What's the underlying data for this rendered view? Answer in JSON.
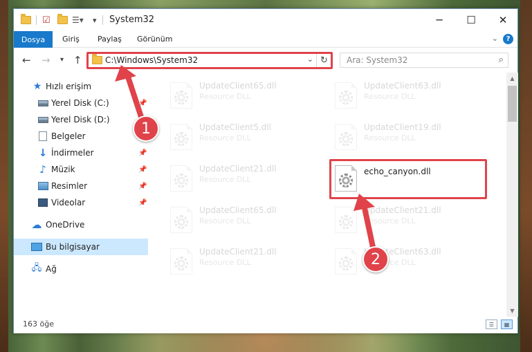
{
  "window": {
    "title": "System32",
    "controls": {
      "minimize": "─",
      "maximize": "☐",
      "close": "✕"
    }
  },
  "ribbon": {
    "tabs": [
      "Dosya",
      "Giriş",
      "Paylaş",
      "Görünüm"
    ],
    "help": "?"
  },
  "nav": {
    "address": "C:\\Windows\\System32",
    "search_placeholder": "Ara: System32"
  },
  "sidebar": {
    "items": [
      {
        "label": "Hızlı erişim",
        "icon": "star-icon",
        "pinned": false
      },
      {
        "label": "Yerel Disk (C:)",
        "icon": "drive-icon",
        "pinned": true
      },
      {
        "label": "Yerel Disk (D:)",
        "icon": "drive-icon",
        "pinned": false
      },
      {
        "label": "Belgeler",
        "icon": "documents-icon",
        "pinned": false
      },
      {
        "label": "İndirmeler",
        "icon": "download-icon",
        "pinned": true
      },
      {
        "label": "Müzik",
        "icon": "music-icon",
        "pinned": true
      },
      {
        "label": "Resimler",
        "icon": "pictures-icon",
        "pinned": true
      },
      {
        "label": "Videolar",
        "icon": "videos-icon",
        "pinned": true
      },
      {
        "label": "OneDrive",
        "icon": "cloud-icon",
        "pinned": false
      },
      {
        "label": "Bu bilgisayar",
        "icon": "computer-icon",
        "pinned": false,
        "selected": true
      },
      {
        "label": "Ağ",
        "icon": "network-icon",
        "pinned": false
      }
    ]
  },
  "files": [
    {
      "name": "UpdateClient65.dll",
      "type": "Resource DLL",
      "faded": true
    },
    {
      "name": "UpdateClient63.dll",
      "type": "Resource DLL",
      "faded": true
    },
    {
      "name": "UpdateClient5.dll",
      "type": "Resource DLL",
      "faded": true
    },
    {
      "name": "UpdateClient19.dll",
      "type": "Resource DLL",
      "faded": true
    },
    {
      "name": "UpdateClient21.dll",
      "type": "Resource DLL",
      "faded": true
    },
    {
      "name": "echo_canyon.dll",
      "type": "",
      "faded": false
    },
    {
      "name": "UpdateClient65.dll",
      "type": "Resource DLL",
      "faded": true
    },
    {
      "name": "UpdateClient21.dll",
      "type": "Resource DLL",
      "faded": true
    },
    {
      "name": "UpdateClient21.dll",
      "type": "Resource DLL",
      "faded": true
    },
    {
      "name": "UpdateClient63.dll",
      "type": "Resource DLL",
      "faded": true
    }
  ],
  "status": {
    "item_count": "163 öğe"
  },
  "annotations": {
    "step1": "1",
    "step2": "2",
    "color": "#e0434a"
  }
}
